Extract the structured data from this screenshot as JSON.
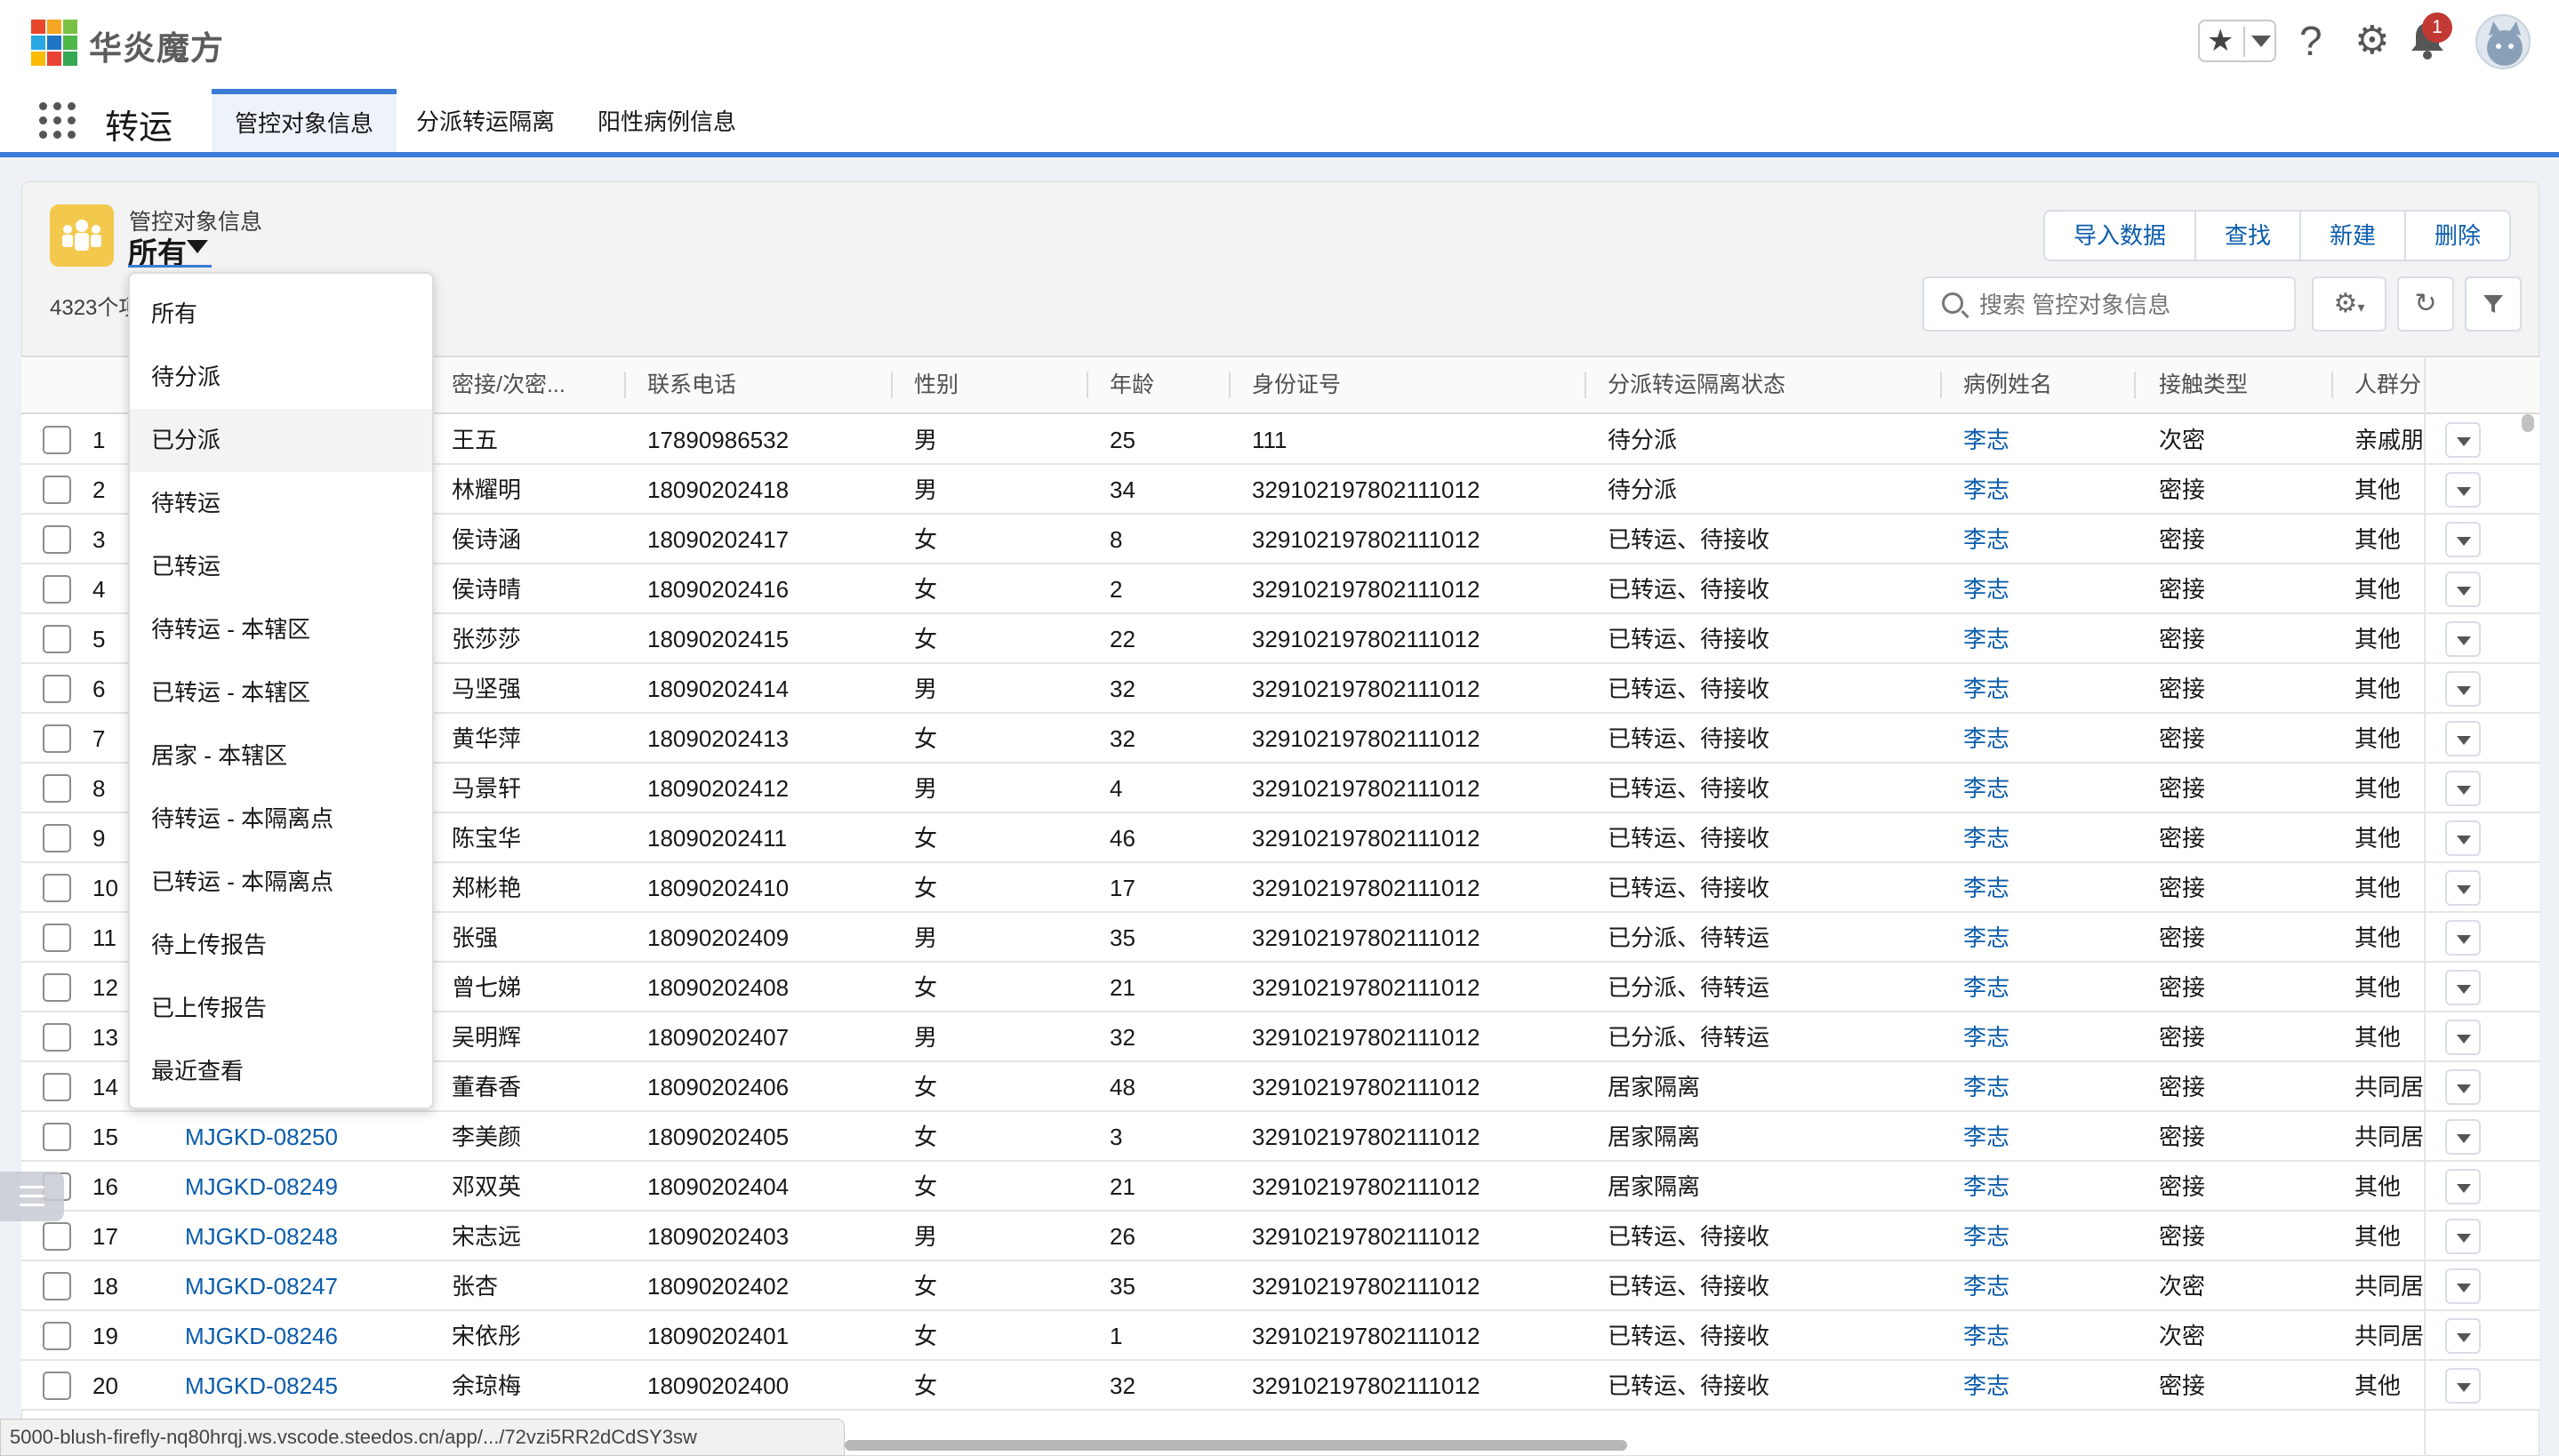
{
  "brand": {
    "name": "华炎魔方",
    "logo_colors": [
      "#e8472c",
      "#f5a623",
      "#7ac143",
      "#29a7e1",
      "#1f76c4",
      "#4fb648",
      "#fbbc05",
      "#ea4335",
      "#34a853"
    ]
  },
  "header": {
    "notification_count": "1",
    "favorite_icon": "star-icon",
    "help_icon": "question-icon",
    "settings_icon": "gear-icon",
    "bell_icon": "bell-icon"
  },
  "nav": {
    "app_name": "转运",
    "tabs": [
      {
        "label": "管控对象信息",
        "active": true
      },
      {
        "label": "分派转运隔离",
        "active": false
      },
      {
        "label": "阳性病例信息",
        "active": false
      }
    ]
  },
  "list": {
    "object_label": "管控对象信息",
    "view_name": "所有",
    "count": "4323个项目",
    "buttons": {
      "import": "导入数据",
      "find": "查找",
      "new": "新建",
      "delete": "删除"
    },
    "search_placeholder": "搜索 管控对象信息"
  },
  "table": {
    "columns": [
      "密接/次密...",
      "联系电话",
      "性别",
      "年龄",
      "身份证号",
      "分派转运隔离状态",
      "病例姓名",
      "接触类型",
      "人群分"
    ],
    "rows": [
      {
        "n": "1",
        "code": "",
        "name": "王五",
        "phone": "17890986532",
        "sex": "男",
        "age": "25",
        "id": "111",
        "status": "待分派",
        "case": "李志",
        "type": "次密",
        "group": "亲戚朋"
      },
      {
        "n": "2",
        "code": "",
        "name": "林耀明",
        "phone": "18090202418",
        "sex": "男",
        "age": "34",
        "id": "329102197802111012",
        "status": "待分派",
        "case": "李志",
        "type": "密接",
        "group": "其他"
      },
      {
        "n": "3",
        "code": "",
        "name": "侯诗涵",
        "phone": "18090202417",
        "sex": "女",
        "age": "8",
        "id": "329102197802111012",
        "status": "已转运、待接收",
        "case": "李志",
        "type": "密接",
        "group": "其他"
      },
      {
        "n": "4",
        "code": "",
        "name": "侯诗晴",
        "phone": "18090202416",
        "sex": "女",
        "age": "2",
        "id": "329102197802111012",
        "status": "已转运、待接收",
        "case": "李志",
        "type": "密接",
        "group": "其他"
      },
      {
        "n": "5",
        "code": "",
        "name": "张莎莎",
        "phone": "18090202415",
        "sex": "女",
        "age": "22",
        "id": "329102197802111012",
        "status": "已转运、待接收",
        "case": "李志",
        "type": "密接",
        "group": "其他"
      },
      {
        "n": "6",
        "code": "",
        "name": "马坚强",
        "phone": "18090202414",
        "sex": "男",
        "age": "32",
        "id": "329102197802111012",
        "status": "已转运、待接收",
        "case": "李志",
        "type": "密接",
        "group": "其他"
      },
      {
        "n": "7",
        "code": "",
        "name": "黄华萍",
        "phone": "18090202413",
        "sex": "女",
        "age": "32",
        "id": "329102197802111012",
        "status": "已转运、待接收",
        "case": "李志",
        "type": "密接",
        "group": "其他"
      },
      {
        "n": "8",
        "code": "",
        "name": "马景轩",
        "phone": "18090202412",
        "sex": "男",
        "age": "4",
        "id": "329102197802111012",
        "status": "已转运、待接收",
        "case": "李志",
        "type": "密接",
        "group": "其他"
      },
      {
        "n": "9",
        "code": "",
        "name": "陈宝华",
        "phone": "18090202411",
        "sex": "女",
        "age": "46",
        "id": "329102197802111012",
        "status": "已转运、待接收",
        "case": "李志",
        "type": "密接",
        "group": "其他"
      },
      {
        "n": "10",
        "code": "",
        "name": "郑彬艳",
        "phone": "18090202410",
        "sex": "女",
        "age": "17",
        "id": "329102197802111012",
        "status": "已转运、待接收",
        "case": "李志",
        "type": "密接",
        "group": "其他"
      },
      {
        "n": "11",
        "code": "",
        "name": "张强",
        "phone": "18090202409",
        "sex": "男",
        "age": "35",
        "id": "329102197802111012",
        "status": "已分派、待转运",
        "case": "李志",
        "type": "密接",
        "group": "其他"
      },
      {
        "n": "12",
        "code": "",
        "name": "曾七娣",
        "phone": "18090202408",
        "sex": "女",
        "age": "21",
        "id": "329102197802111012",
        "status": "已分派、待转运",
        "case": "李志",
        "type": "密接",
        "group": "其他"
      },
      {
        "n": "13",
        "code": "",
        "name": "吴明辉",
        "phone": "18090202407",
        "sex": "男",
        "age": "32",
        "id": "329102197802111012",
        "status": "已分派、待转运",
        "case": "李志",
        "type": "密接",
        "group": "其他"
      },
      {
        "n": "14",
        "code": "",
        "name": "董春香",
        "phone": "18090202406",
        "sex": "女",
        "age": "48",
        "id": "329102197802111012",
        "status": "居家隔离",
        "case": "李志",
        "type": "密接",
        "group": "共同居"
      },
      {
        "n": "15",
        "code": "MJGKD-08250",
        "name": "李美颜",
        "phone": "18090202405",
        "sex": "女",
        "age": "3",
        "id": "329102197802111012",
        "status": "居家隔离",
        "case": "李志",
        "type": "密接",
        "group": "共同居"
      },
      {
        "n": "16",
        "code": "MJGKD-08249",
        "name": "邓双英",
        "phone": "18090202404",
        "sex": "女",
        "age": "21",
        "id": "329102197802111012",
        "status": "居家隔离",
        "case": "李志",
        "type": "密接",
        "group": "其他"
      },
      {
        "n": "17",
        "code": "MJGKD-08248",
        "name": "宋志远",
        "phone": "18090202403",
        "sex": "男",
        "age": "26",
        "id": "329102197802111012",
        "status": "已转运、待接收",
        "case": "李志",
        "type": "密接",
        "group": "其他"
      },
      {
        "n": "18",
        "code": "MJGKD-08247",
        "name": "张杏",
        "phone": "18090202402",
        "sex": "女",
        "age": "35",
        "id": "329102197802111012",
        "status": "已转运、待接收",
        "case": "李志",
        "type": "次密",
        "group": "共同居"
      },
      {
        "n": "19",
        "code": "MJGKD-08246",
        "name": "宋依彤",
        "phone": "18090202401",
        "sex": "女",
        "age": "1",
        "id": "329102197802111012",
        "status": "已转运、待接收",
        "case": "李志",
        "type": "次密",
        "group": "共同居"
      },
      {
        "n": "20",
        "code": "MJGKD-08245",
        "name": "余琼梅",
        "phone": "18090202400",
        "sex": "女",
        "age": "32",
        "id": "329102197802111012",
        "status": "已转运、待接收",
        "case": "李志",
        "type": "密接",
        "group": "其他"
      }
    ]
  },
  "view_dropdown": {
    "items": [
      "所有",
      "待分派",
      "已分派",
      "待转运",
      "已转运",
      "待转运 - 本辖区",
      "已转运 - 本辖区",
      "居家 - 本辖区",
      "待转运 - 本隔离点",
      "已转运 - 本隔离点",
      "待上传报告",
      "已上传报告",
      "最近查看"
    ],
    "hovered": "已分派"
  },
  "status_url": "5000-blush-firefly-nq80hrqj.ws.vscode.steedos.cn/app/.../72vzi5RR2dCdSY3sw",
  "colors": {
    "accent": "#3d7bd9",
    "link": "#0b5cab",
    "object_icon": "#f2c94c",
    "badge": "#c23934"
  }
}
